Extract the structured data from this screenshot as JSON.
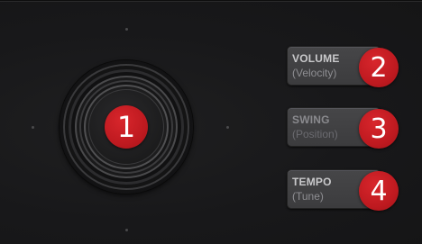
{
  "encoder": {
    "badge": "1"
  },
  "buttons": [
    {
      "title": "VOLUME",
      "subtitle": "(Velocity)",
      "badge": "2"
    },
    {
      "title": "SWING",
      "subtitle": "(Position)",
      "badge": "3"
    },
    {
      "title": "TEMPO",
      "subtitle": "(Tune)",
      "badge": "4"
    }
  ],
  "colors": {
    "panel_background": "#1a1a1b",
    "badge_red": "#c41e24",
    "button_face": "#424244",
    "label_text": "#c9c9cb"
  }
}
